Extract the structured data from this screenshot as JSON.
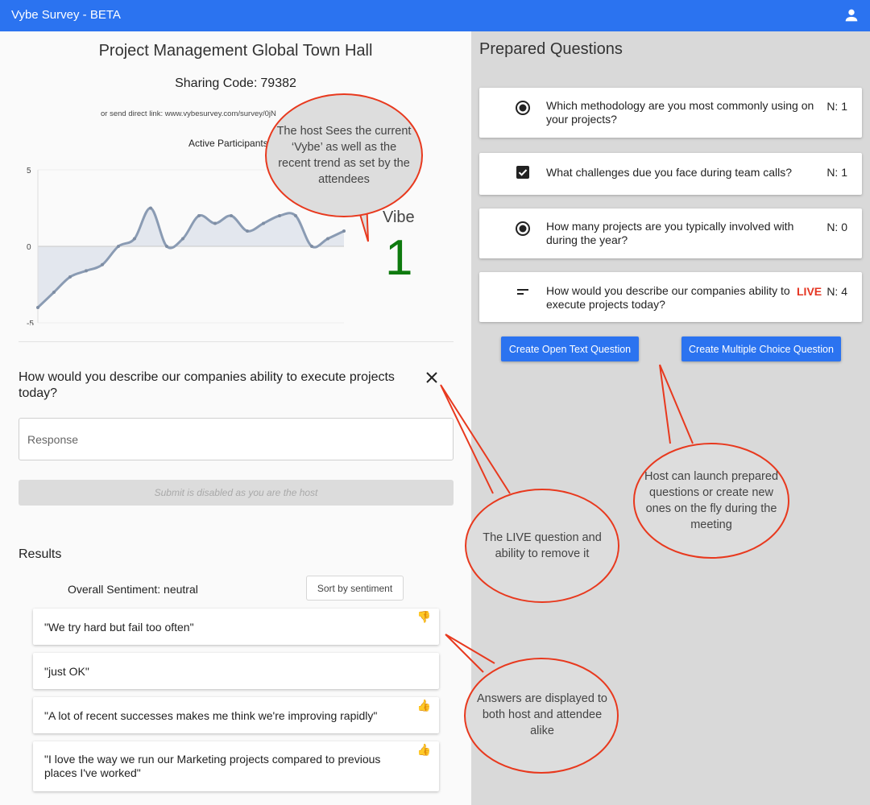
{
  "app": {
    "title": "Vybe Survey - BETA",
    "user_icon": "account-icon"
  },
  "event": {
    "title": "Project Management Global Town Hall",
    "sharing_code_label": "Sharing Code:",
    "sharing_code": "79382",
    "direct_link": "or send direct link: www.vybesurvey.com/survey/0jN",
    "participants_label": "Active Participants"
  },
  "vibe": {
    "label": "Vibe",
    "value": "1",
    "value_color": "#0e7a0e"
  },
  "chart_data": {
    "type": "line",
    "title": "",
    "ylim": [
      -5,
      5
    ],
    "yticks": [
      "5",
      "0",
      "-5"
    ],
    "fill": "area-to-zero",
    "line_color": "#8a9bb3",
    "values": [
      -4.0,
      -3.0,
      -2.0,
      -1.6,
      -1.2,
      0.0,
      0.5,
      2.5,
      0.0,
      0.5,
      2.0,
      1.5,
      2.0,
      1.0,
      1.5,
      2.0,
      2.0,
      0.0,
      0.5,
      1.0
    ]
  },
  "live_question": {
    "text": "How would you describe our companies ability to execute projects today?",
    "close_icon": "close-icon"
  },
  "response": {
    "placeholder": "Response",
    "value": ""
  },
  "submit": {
    "label": "Submit is disabled as you are the host"
  },
  "results": {
    "heading": "Results",
    "sentiment_label": "Overall Sentiment: neutral",
    "sort_label": "Sort by sentiment",
    "answers": [
      {
        "text": "\"We try hard but fail too often\"",
        "icon": "thumbs-down-icon"
      },
      {
        "text": "\"just OK\"",
        "icon": ""
      },
      {
        "text": "\"A lot of recent successes makes me think we're improving rapidly\"",
        "icon": "thumbs-up-icon"
      },
      {
        "text": "\"I love the way we run our Marketing projects compared to previous places I've worked\"",
        "icon": "thumbs-up-icon"
      }
    ]
  },
  "prepared": {
    "heading": "Prepared Questions",
    "live_label": "LIVE",
    "live_color": "#e53522",
    "questions": [
      {
        "icon": "radio-icon",
        "text": "Which methodology are you most commonly using on your projects?",
        "count": "N: 1",
        "live": false
      },
      {
        "icon": "checkbox-icon",
        "text": "What challenges due you face during team calls?",
        "count": "N: 1",
        "live": false
      },
      {
        "icon": "radio-icon",
        "text": "How many projects are you typically involved with during the year?",
        "count": "N: 0",
        "live": false
      },
      {
        "icon": "short-text-icon",
        "text": "How would you describe our companies ability to execute projects today?",
        "count": "N: 4",
        "live": true
      }
    ],
    "create_open_label": "Create Open Text Question",
    "create_mc_label": "Create Multiple Choice Question"
  },
  "annotations": [
    {
      "text": "The host Sees the current ‘Vybe’ as well as the recent trend as set by the attendees"
    },
    {
      "text": "The LIVE question and ability to remove it"
    },
    {
      "text": "Host can launch prepared questions or create new ones on the fly during the meeting"
    },
    {
      "text": "Answers are displayed to both host and attendee alike"
    }
  ],
  "colors": {
    "accent": "#2b73f0",
    "callout_stroke": "#e8391e",
    "callout_fill": "#dddddd"
  }
}
